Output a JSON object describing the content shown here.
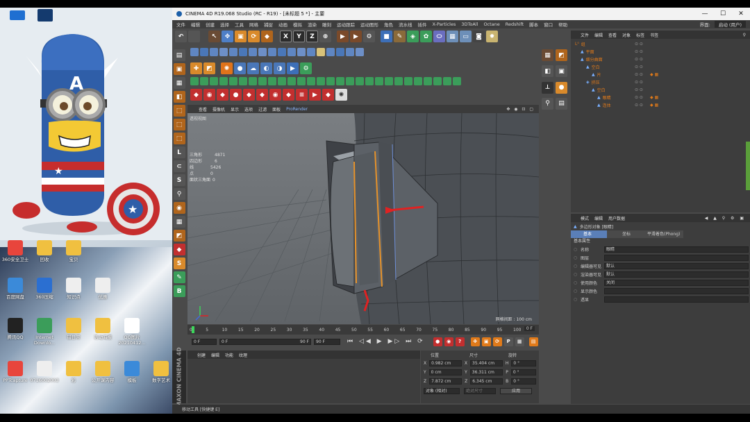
{
  "window": {
    "title": "CINEMA 4D R19.068 Studio (RC - R19) - [未标题 5 *] - 主要",
    "min": "—",
    "max": "☐",
    "close": "✕"
  },
  "menu": {
    "items": [
      "文件",
      "编辑",
      "创建",
      "选择",
      "工具",
      "网格",
      "捕捉",
      "动画",
      "模拟",
      "渲染",
      "雕刻",
      "运动跟踪",
      "运动图形",
      "角色",
      "流水线",
      "插件",
      "X-Particles",
      "3DToAll",
      "Octane",
      "Redshift",
      "脚本",
      "窗口",
      "帮助"
    ],
    "layout_label": "界面:",
    "layout_value": "启动 (用户)"
  },
  "viewport": {
    "menu": [
      "查看",
      "摄像机",
      "显示",
      "选项",
      "过滤",
      "面板",
      "ProRender"
    ],
    "title": "透视视图",
    "stats": [
      {
        "label": "三角形",
        "value": "4871"
      },
      {
        "label": "四边形",
        "value": "6"
      },
      {
        "label": "线",
        "value": "5426"
      },
      {
        "label": "点",
        "value": "0"
      },
      {
        "label": "面状三角面",
        "value": "0"
      }
    ],
    "grid_label": "网格间距 : 100 cm"
  },
  "timeline": {
    "ticks": [
      "0",
      "5",
      "10",
      "15",
      "20",
      "25",
      "30",
      "35",
      "40",
      "45",
      "50",
      "55",
      "60",
      "65",
      "70",
      "75",
      "80",
      "85",
      "90",
      "95",
      "100"
    ],
    "current_frame": "0 F",
    "start_frame": "0 F",
    "end_frame": "90 F",
    "preview_start": "0 F",
    "preview_end": "90 F",
    "max_frame": "0 F",
    "frame_indicator": "0 F"
  },
  "material_panel": {
    "tabs": [
      "创建",
      "编辑",
      "功能",
      "纹理"
    ]
  },
  "coordinates": {
    "headers": [
      "位置",
      "尺寸",
      "旋转"
    ],
    "rows": [
      {
        "axis": "X",
        "pos": "0.982 cm",
        "size_axis": "X",
        "size": "35.404 cm",
        "rot_axis": "H",
        "rot": "0 °"
      },
      {
        "axis": "Y",
        "pos": "0 cm",
        "size_axis": "Y",
        "size": "36.311 cm",
        "rot_axis": "P",
        "rot": "0 °"
      },
      {
        "axis": "Z",
        "pos": "7.872 cm",
        "size_axis": "Z",
        "size": "6.345 cm",
        "rot_axis": "B",
        "rot": "0 °"
      }
    ],
    "mode": "对象 (相对)",
    "size_mode": "绝对尺寸",
    "apply": "应用"
  },
  "object_manager": {
    "menu": [
      "文件",
      "编辑",
      "查看",
      "对象",
      "标签",
      "书签"
    ],
    "objects": [
      {
        "name": "组",
        "indent": 0
      },
      {
        "name": "平面",
        "indent": 1
      },
      {
        "name": "细分曲面",
        "indent": 1
      },
      {
        "name": "空白",
        "indent": 2
      },
      {
        "name": "片",
        "indent": 3
      },
      {
        "name": "挤压",
        "indent": 2
      },
      {
        "name": "空白",
        "indent": 3
      },
      {
        "name": "眼睛",
        "indent": 4
      },
      {
        "name": "连体",
        "indent": 4
      }
    ]
  },
  "attributes": {
    "menu": [
      "模式",
      "编辑",
      "用户数据"
    ],
    "object_title": "多边形对象 [眼睛]",
    "tabs": [
      "基本",
      "坐标",
      "平滑着色(Phong)"
    ],
    "section": "基本属性",
    "fields": [
      {
        "label": "名称",
        "value": "眼睛"
      },
      {
        "label": "图层",
        "value": ""
      },
      {
        "label": "编辑器可见",
        "value": "默认"
      },
      {
        "label": "渲染器可见",
        "value": "默认"
      },
      {
        "label": "使用颜色",
        "value": "关闭"
      },
      {
        "label": "显示颜色",
        "value": ""
      },
      {
        "label": "透显",
        "value": ""
      }
    ]
  },
  "statusbar": {
    "text": "移动工具 [快捷键 E]"
  },
  "brand": "MAXON CINEMA 4D",
  "desktop": {
    "icons": [
      {
        "label": "360安全卫士"
      },
      {
        "label": "回收"
      },
      {
        "label": "宝贝"
      },
      {
        "label": "百度网盘"
      },
      {
        "label": "360压缩"
      },
      {
        "label": "知识点"
      },
      {
        "label": "优惠"
      },
      {
        "label": "腾讯QQ"
      },
      {
        "label": "Internet Downlo..."
      },
      {
        "label": "错日常"
      },
      {
        "label": "活动海报"
      },
      {
        "label": "QQ图片 20210412..."
      },
      {
        "label": "PPTcapture"
      },
      {
        "label": "0716002003"
      },
      {
        "label": "彩"
      },
      {
        "label": "公开课内容"
      },
      {
        "label": "模板"
      },
      {
        "label": "数字艺术"
      }
    ]
  },
  "colors": {
    "accent": "#e07a1a",
    "bg_panel": "#3d3d3d",
    "viewport_bg": "#6a6e72",
    "title_bg": "#f2f2f2"
  }
}
